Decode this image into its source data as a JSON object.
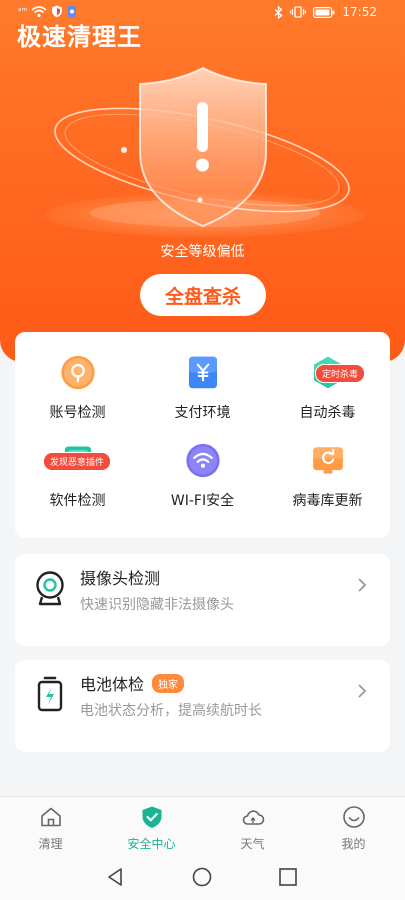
{
  "status_bar": {
    "signal": "ᵃᵐ",
    "time": "17:52"
  },
  "app": {
    "title": "极速清理王"
  },
  "hero": {
    "security_level_text": "安全等级偏低",
    "scan_button_label": "全盘查杀"
  },
  "features": [
    {
      "label": "账号检测",
      "icon": "search-icon",
      "badge": ""
    },
    {
      "label": "支付环境",
      "icon": "yuan-icon",
      "badge": ""
    },
    {
      "label": "自动杀毒",
      "icon": "lightning-shield-icon",
      "badge": "定时杀毒"
    },
    {
      "label": "软件检测",
      "icon": "chart-app-icon",
      "badge": "发现恶意插件"
    },
    {
      "label": "WI-FI安全",
      "icon": "wifi-icon",
      "badge": ""
    },
    {
      "label": "病毒库更新",
      "icon": "refresh-monitor-icon",
      "badge": ""
    }
  ],
  "cards": {
    "camera": {
      "title": "摄像头检测",
      "subtitle": "快速识别隐藏非法摄像头"
    },
    "battery": {
      "title": "电池体检",
      "tag": "独家",
      "subtitle": "电池状态分析，提高续航时长"
    }
  },
  "tabs": [
    {
      "label": "清理",
      "icon": "home-icon"
    },
    {
      "label": "安全中心",
      "icon": "shield-check-icon",
      "active": true
    },
    {
      "label": "天气",
      "icon": "cloud-icon"
    },
    {
      "label": "我的",
      "icon": "smile-icon"
    }
  ],
  "colors": {
    "hero_orange": "#ff6a22",
    "accent_green": "#1ab394",
    "badge_red": "#f24c3d"
  }
}
